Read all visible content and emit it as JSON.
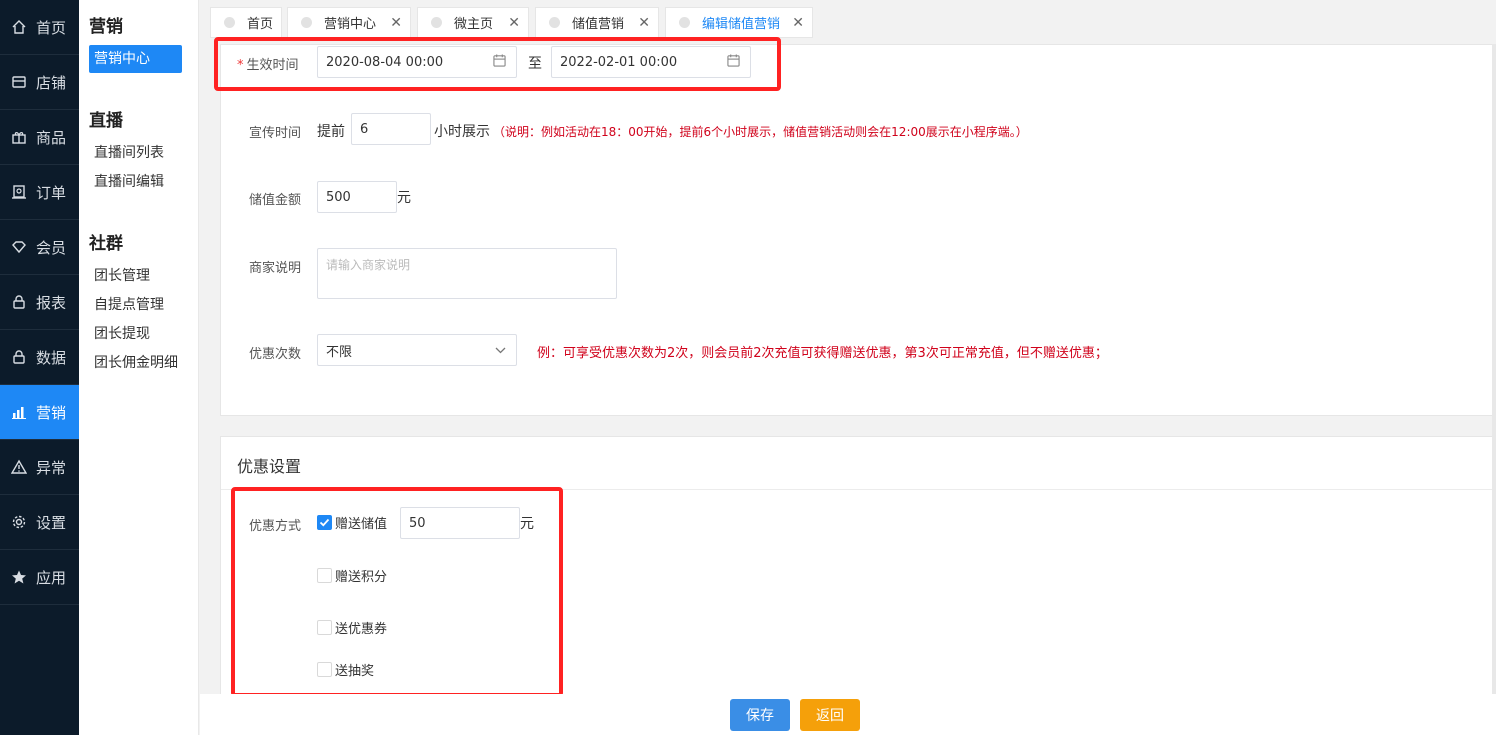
{
  "nav": {
    "items": [
      {
        "label": "首页",
        "icon": "home-icon"
      },
      {
        "label": "店铺",
        "icon": "store-icon"
      },
      {
        "label": "商品",
        "icon": "gift-icon"
      },
      {
        "label": "订单",
        "icon": "order-icon"
      },
      {
        "label": "会员",
        "icon": "diamond-icon"
      },
      {
        "label": "报表",
        "icon": "lock-icon"
      },
      {
        "label": "数据",
        "icon": "lock-icon"
      },
      {
        "label": "营销",
        "icon": "bar-chart-icon"
      },
      {
        "label": "异常",
        "icon": "warning-icon"
      },
      {
        "label": "设置",
        "icon": "gear-icon"
      },
      {
        "label": "应用",
        "icon": "star-icon"
      }
    ],
    "active": "营销"
  },
  "submenu": {
    "sections": [
      {
        "title": "营销",
        "items": [
          "营销中心"
        ]
      },
      {
        "title": "直播",
        "items": [
          "直播间列表",
          "直播间编辑"
        ]
      },
      {
        "title": "社群",
        "items": [
          "团长管理",
          "自提点管理",
          "团长提现",
          "团长佣金明细"
        ]
      }
    ]
  },
  "tabs": [
    {
      "label": "首页",
      "closable": false
    },
    {
      "label": "营销中心",
      "closable": true
    },
    {
      "label": "微主页",
      "closable": true
    },
    {
      "label": "储值营销",
      "closable": true
    },
    {
      "label": "编辑储值营销",
      "closable": true
    }
  ],
  "form": {
    "effective_label": "生效时间",
    "required_mark": "*",
    "start_date": "2020-08-04 00:00",
    "to_text": "至",
    "end_date": "2022-02-01 00:00",
    "promo_label": "宣传时间",
    "promo_prefix": "提前",
    "promo_hours": "6",
    "promo_suffix": "小时展示",
    "promo_note": "（说明：例如活动在18：00开始，提前6个小时展示，储值营销活动则会在12:00展示在小程序端。）",
    "amount_label": "储值金额",
    "amount_value": "500",
    "amount_unit": "元",
    "desc_label": "商家说明",
    "desc_placeholder": "请输入商家说明",
    "times_label": "优惠次数",
    "times_value": "不限",
    "times_note": "例：可享受优惠次数为2次，则会员前2次充值可获得赠送优惠，第3次可正常充值，但不赠送优惠；"
  },
  "discount": {
    "title": "优惠设置",
    "method_label": "优惠方式",
    "options": [
      {
        "label": "赠送储值",
        "checked": true
      },
      {
        "label": "赠送积分",
        "checked": false
      },
      {
        "label": "送优惠券",
        "checked": false
      },
      {
        "label": "送抽奖",
        "checked": false
      }
    ],
    "gift_value": "50",
    "gift_unit": "元"
  },
  "footer": {
    "save_label": "保存",
    "back_label": "返回",
    "save_color": "#3a8ee6",
    "back_color": "#f5a00a"
  }
}
